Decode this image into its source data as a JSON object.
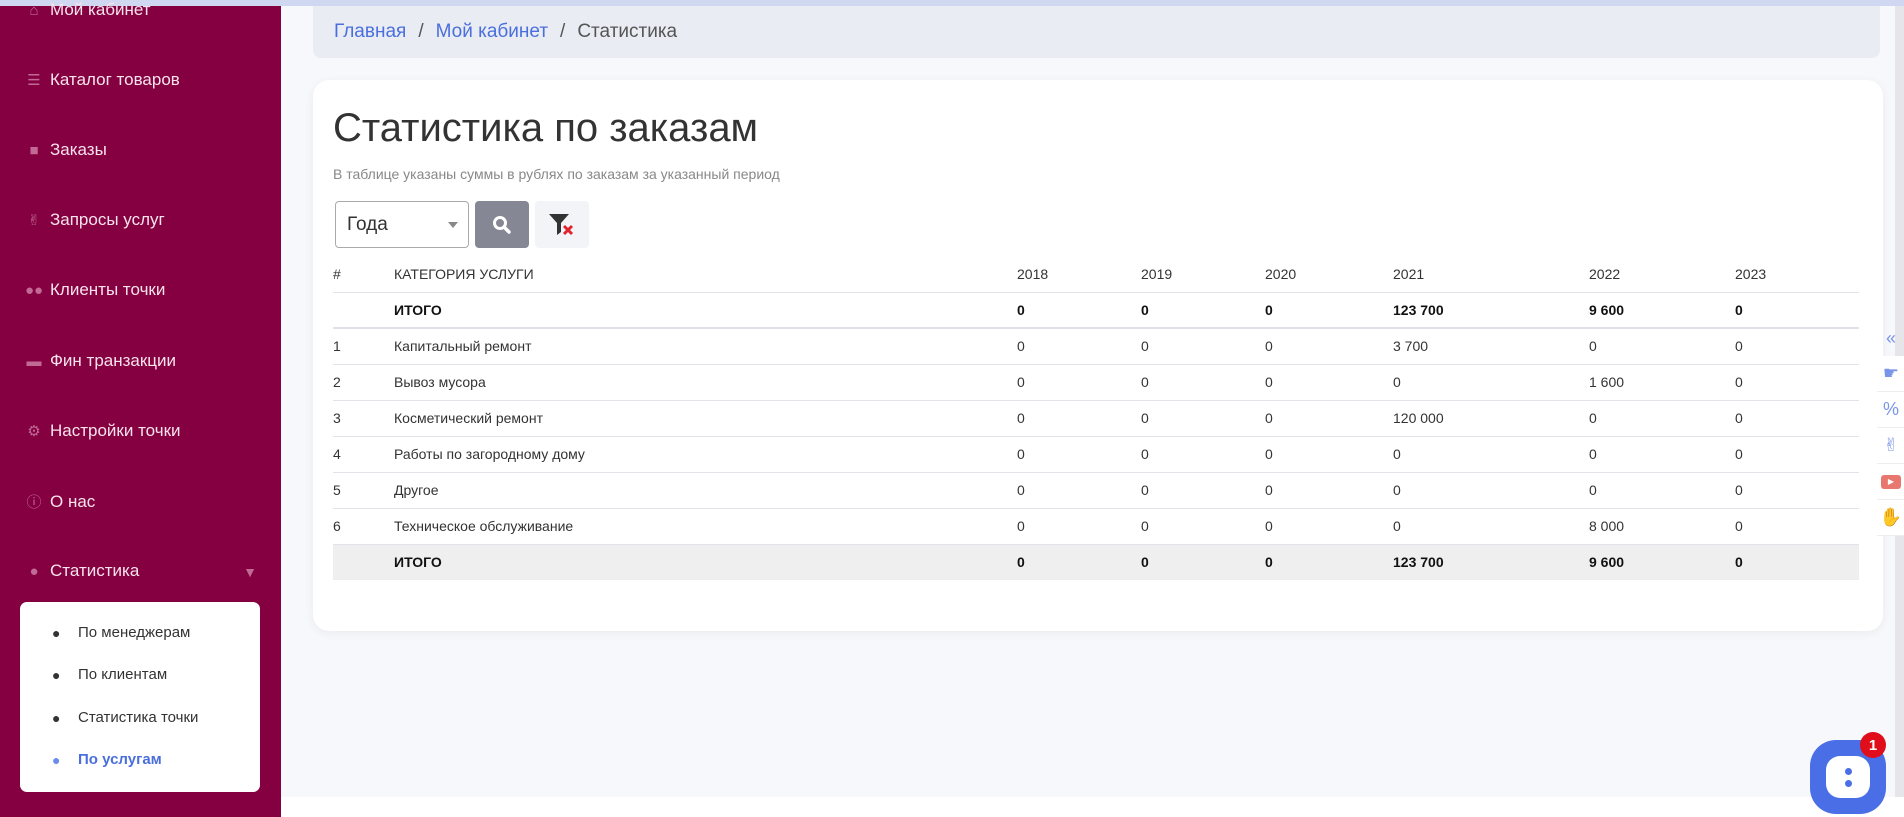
{
  "colors": {
    "sidebar": "#850040",
    "accent": "#4a6fdc",
    "chat": "#4a6ee6",
    "badge": "#e00d1a"
  },
  "sidebar": {
    "items": [
      {
        "label": "Мой кабинет",
        "icon": "home-icon"
      },
      {
        "label": "Каталог товаров",
        "icon": "list-icon"
      },
      {
        "label": "Заказы",
        "icon": "shopping-bag-icon"
      },
      {
        "label": "Запросы услуг",
        "icon": "hand-peace-icon"
      },
      {
        "label": "Клиенты точки",
        "icon": "users-icon"
      },
      {
        "label": "Фин транзакции",
        "icon": "money-icon"
      },
      {
        "label": "Настройки точки",
        "icon": "cogs-icon"
      },
      {
        "label": "О нас",
        "icon": "info-icon"
      },
      {
        "label": "Статистика",
        "icon": "lightbulb-icon"
      }
    ],
    "submenu": [
      {
        "label": "По менеджерам"
      },
      {
        "label": "По клиентам"
      },
      {
        "label": "Статистика точки"
      },
      {
        "label": "По услугам",
        "active": true
      }
    ]
  },
  "breadcrumb": {
    "home": "Главная",
    "cabinet": "Мой кабинет",
    "current": "Статистика",
    "sep": "/"
  },
  "page": {
    "title": "Статистика по заказам",
    "subtitle": "В таблице указаны суммы в рублях по заказам за указанный период"
  },
  "filter": {
    "period": "Года"
  },
  "table": {
    "headers": [
      "#",
      "Категория услуги",
      "2018",
      "2019",
      "2020",
      "2021",
      "2022",
      "2023"
    ],
    "total_top": [
      "",
      "ИТОГО",
      "0",
      "0",
      "0",
      "123 700",
      "9 600",
      "0"
    ],
    "rows": [
      [
        "1",
        "Капитальный ремонт",
        "0",
        "0",
        "0",
        "3 700",
        "0",
        "0"
      ],
      [
        "2",
        "Вывоз мусора",
        "0",
        "0",
        "0",
        "0",
        "1 600",
        "0"
      ],
      [
        "3",
        "Косметический ремонт",
        "0",
        "0",
        "0",
        "120 000",
        "0",
        "0"
      ],
      [
        "4",
        "Работы по загородному дому",
        "0",
        "0",
        "0",
        "0",
        "0",
        "0"
      ],
      [
        "5",
        "Другое",
        "0",
        "0",
        "0",
        "0",
        "0",
        "0"
      ],
      [
        "6",
        "Техническое обслуживание",
        "0",
        "0",
        "0",
        "0",
        "8 000",
        "0"
      ]
    ],
    "total_bottom": [
      "",
      "ИТОГО",
      "0",
      "0",
      "0",
      "123 700",
      "9 600",
      "0"
    ]
  },
  "rightbar": [
    "collapse-icon",
    "pointing-hand-icon",
    "percent-icon",
    "hand-peace-icon",
    "youtube-icon",
    "hand-icon"
  ],
  "chat": {
    "badge": "1"
  }
}
